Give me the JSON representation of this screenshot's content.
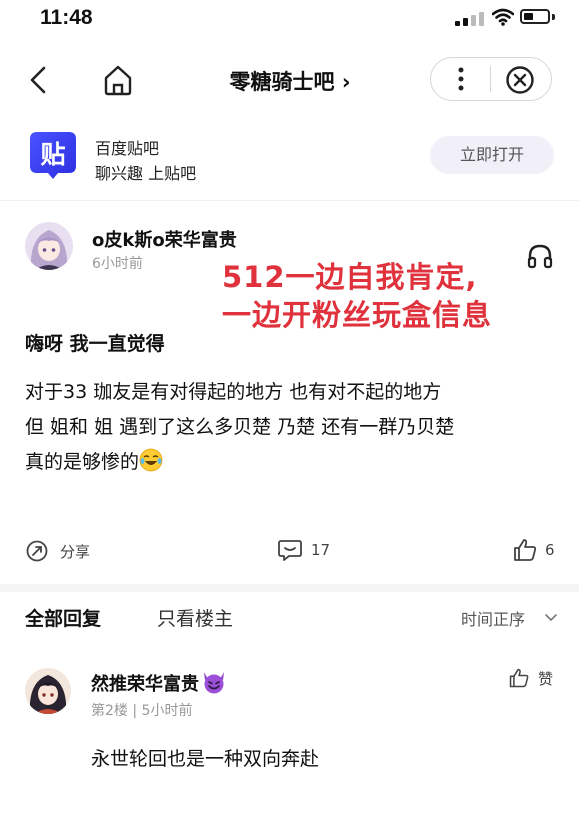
{
  "status_bar": {
    "time": "11:48",
    "battery_level": 0.3
  },
  "nav": {
    "title": "零糖骑士吧 ›"
  },
  "app_banner": {
    "name": "百度贴吧",
    "slogan": "聊兴趣 上贴吧",
    "open_label": "立即打开"
  },
  "post": {
    "author": "o皮k斯o荣华富贵",
    "time": "6小时前",
    "overlay_line1": "512一边自我肯定,",
    "overlay_line2": "一边开粉丝玩盒信息",
    "heading": "嗨呀 我一直觉得",
    "body_line1": "对于33 珈友是有对得起的地方 也有对不起的地方",
    "body_line2": "但    姐和    姐 遇到了这么多贝楚 乃楚 还有一群乃贝楚",
    "body_line3": "真的是够惨的",
    "share_label": "分享",
    "comment_count": "17",
    "like_count": "6"
  },
  "replies": {
    "tab_all": "全部回复",
    "tab_op": "只看楼主",
    "sort_label": "时间正序",
    "items": [
      {
        "author": "然推荣华富贵",
        "floor": "第2楼",
        "separator": "|",
        "time": "5小时前",
        "like_label": "赞",
        "content": "永世轮回也是一种双向奔赴"
      }
    ]
  },
  "colors": {
    "overlay_red": "#e0323c",
    "open_button_bg": "#f1eff8",
    "app_logo": "#3b3ff0"
  }
}
